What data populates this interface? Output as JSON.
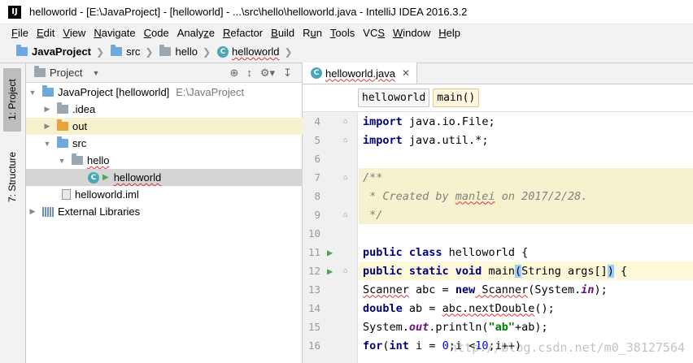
{
  "window": {
    "title": "helloworld - [E:\\JavaProject] - [helloworld] - ...\\src\\hello\\helloworld.java - IntelliJ IDEA 2016.3.2",
    "app_icon_text": "IJ"
  },
  "menubar": {
    "items": [
      {
        "mnemonic": "F",
        "rest": "ile"
      },
      {
        "mnemonic": "E",
        "rest": "dit"
      },
      {
        "mnemonic": "V",
        "rest": "iew"
      },
      {
        "mnemonic": "N",
        "rest": "avigate"
      },
      {
        "mnemonic": "C",
        "rest": "ode"
      },
      {
        "pre": "Analy",
        "mnemonic": "z",
        "rest": "e"
      },
      {
        "mnemonic": "R",
        "rest": "efactor"
      },
      {
        "mnemonic": "B",
        "rest": "uild"
      },
      {
        "pre": "R",
        "mnemonic": "u",
        "rest": "n"
      },
      {
        "mnemonic": "T",
        "rest": "ools"
      },
      {
        "pre": "VC",
        "mnemonic": "S",
        "rest": ""
      },
      {
        "mnemonic": "W",
        "rest": "indow"
      },
      {
        "mnemonic": "H",
        "rest": "elp"
      }
    ]
  },
  "navbar": {
    "crumbs": [
      "JavaProject",
      "src",
      "hello",
      "helloworld"
    ]
  },
  "left_tabs": {
    "project": "1: Project",
    "structure": "7: Structure"
  },
  "project_panel": {
    "header": "Project",
    "tree": [
      {
        "label": "JavaProject [helloworld]",
        "hint": "E:\\JavaProject"
      },
      {
        "label": ".idea"
      },
      {
        "label": "out"
      },
      {
        "label": "src"
      },
      {
        "label": "hello"
      },
      {
        "label": "helloworld"
      },
      {
        "label": "helloworld.iml"
      },
      {
        "label": "External Libraries"
      }
    ]
  },
  "editor": {
    "tab_label": "helloworld.java",
    "breadcrumb": [
      "helloworld",
      "main()"
    ],
    "lines": [
      {
        "n": "4"
      },
      {
        "n": "5"
      },
      {
        "n": "6"
      },
      {
        "n": "7"
      },
      {
        "n": "8"
      },
      {
        "n": "9"
      },
      {
        "n": "10"
      },
      {
        "n": "11"
      },
      {
        "n": "12"
      },
      {
        "n": "13"
      },
      {
        "n": "14"
      },
      {
        "n": "15"
      },
      {
        "n": "16"
      }
    ],
    "code": {
      "l4_kw": "import",
      "l4_rest": " java.io.File;",
      "l5_kw": "import",
      "l5_rest": " java.util.*;",
      "l7": "/**",
      "l8_pre": " * Created by ",
      "l8_name": "manlei",
      "l8_post": " on 2017/2/28.",
      "l9": " */",
      "l11_kw": "public class",
      "l11_rest": " helloworld {",
      "l12_kw": "public static void",
      "l12_name": " main",
      "l12_paren_open": "(",
      "l12_mid": "String args[]",
      "l12_paren_close": ")",
      "l12_end": " {",
      "l13_type": "Scanner",
      "l13_mid": " abc = ",
      "l13_kw": "new",
      "l13_ctor": " Scanner",
      "l13_arg_pre": "(System.",
      "l13_field": "in",
      "l13_end": ");",
      "l14_kw": "double",
      "l14_mid": " ab = ",
      "l14_call": "abc.nextDouble",
      "l14_end": "();",
      "l15_pre": "System.",
      "l15_field": "out",
      "l15_mid": ".println(",
      "l15_str": "\"ab\"",
      "l15_end": "+ab);",
      "l16_kw1": "for",
      "l16_a": "(",
      "l16_kw2": "int",
      "l16_b": " i = ",
      "l16_n1": "0",
      "l16_c": ";i <",
      "l16_n2": "10",
      "l16_d": ";i++)"
    }
  },
  "watermark": "http://blog.csdn.net/m0_38127564",
  "colors": {
    "keyword": "#000080",
    "comment": "#808080",
    "string": "#008000",
    "doc_background": "#f6f2cf",
    "selection": "#d5d5d5"
  }
}
